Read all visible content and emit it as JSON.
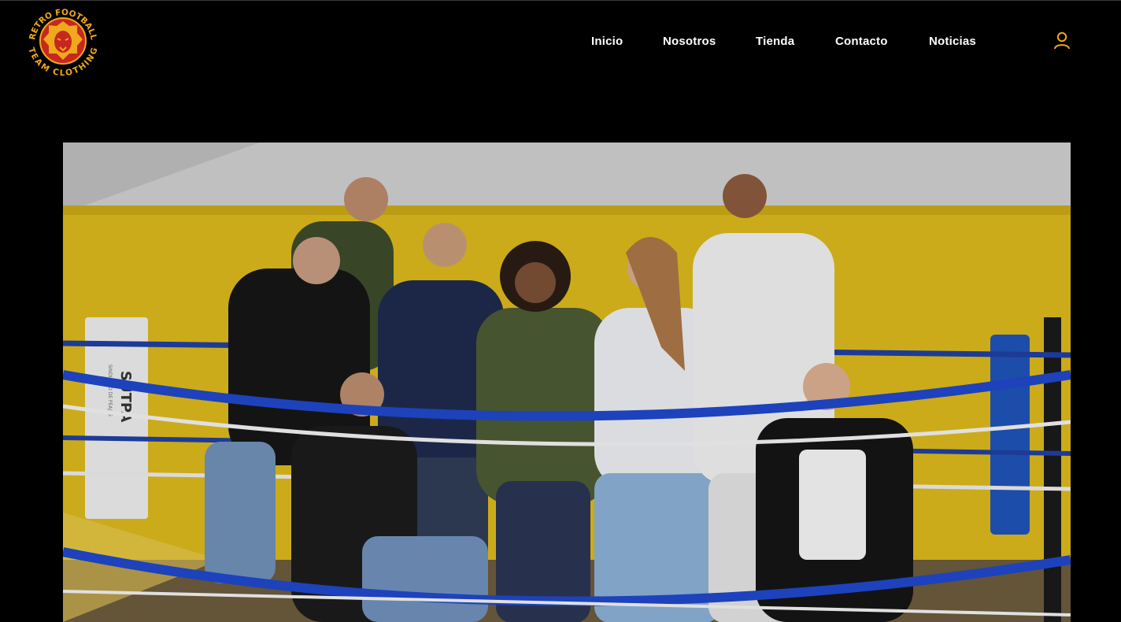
{
  "brand": {
    "logo_top_text": "RETRO FOOTBALL",
    "logo_bottom_text": "TEAM CLOTHING"
  },
  "nav": {
    "items": [
      {
        "label": "Inicio"
      },
      {
        "label": "Nosotros"
      },
      {
        "label": "Tienda"
      },
      {
        "label": "Contacto"
      },
      {
        "label": "Noticias"
      }
    ]
  },
  "icons": {
    "account": "user-icon"
  },
  "hero": {
    "banner_text": "SUTPA",
    "banner_subtext": "SINDICATO DE PEAJES"
  },
  "colors": {
    "background": "#000000",
    "accent": "#f0a81c",
    "logo_red": "#c7271f",
    "nav_text": "#ffffff",
    "wall_yellow": "#d8b61c",
    "rope_blue": "#1f47c8"
  }
}
